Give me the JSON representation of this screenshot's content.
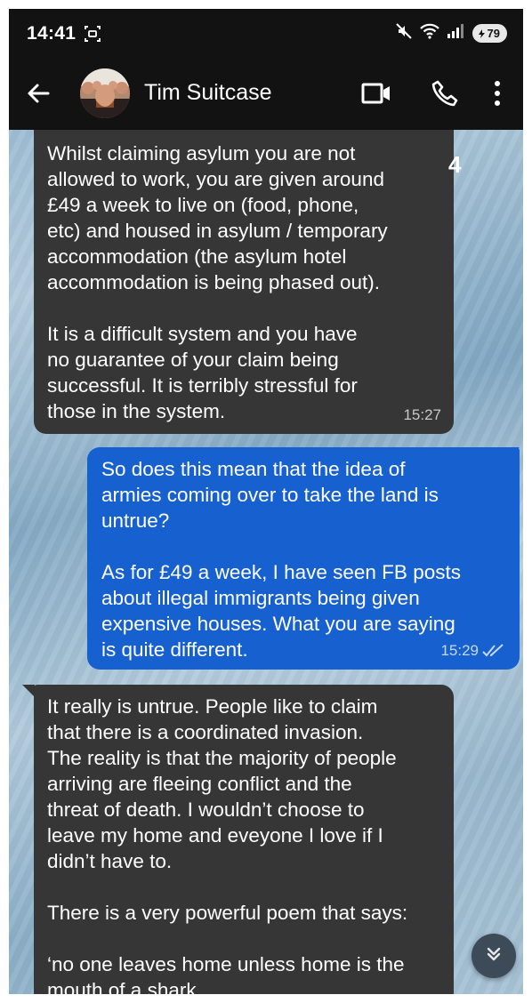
{
  "status_bar": {
    "time": "14:41",
    "battery": "79"
  },
  "header": {
    "contact_name": "Tim Suitcase"
  },
  "overlay": {
    "page_number": "4"
  },
  "messages": [
    {
      "direction": "incoming",
      "paragraphs": [
        [
          "Whilst claiming asylum you are not",
          "allowed to work, you are given around",
          "£49 a week to live on (food, phone,",
          "etc) and housed in asylum / temporary",
          "accommodation (the asylum hotel",
          "accommodation is being phased out)."
        ],
        [
          "It is a difficult system and you have",
          "no guarantee of your claim being",
          "successful. It is terribly stressful for",
          "those in the system."
        ]
      ],
      "time": "15:27"
    },
    {
      "direction": "outgoing",
      "paragraphs": [
        [
          "So does this mean that the idea of",
          "armies coming over to take the land is",
          "untrue?"
        ],
        [
          "As for £49 a week, I have seen FB posts",
          "about illegal immigrants being given",
          "expensive houses. What you are saying",
          "is quite different."
        ]
      ],
      "time": "15:29",
      "status": "read"
    },
    {
      "direction": "incoming",
      "paragraphs": [
        [
          "It really is untrue. People like to claim",
          "that there is a coordinated invasion.",
          "The reality is that the majority of people",
          "arriving are fleeing conflict and the",
          "threat of death. I wouldn’t choose to",
          "leave my home and eveyone I love if I",
          "didn’t have to."
        ],
        [
          "There is a very powerful poem that says:"
        ],
        [
          "‘no one leaves home unless home is the",
          "mouth of a shark,"
        ]
      ]
    }
  ],
  "colors": {
    "app_bar": "#121212",
    "incoming_bubble": "#363636",
    "outgoing_bubble": "#1760d0",
    "wallpaper": "#8ab1cc"
  },
  "icons": [
    "screen-record-icon",
    "mute-icon",
    "wifi-icon",
    "signal-icon",
    "battery-icon",
    "back-arrow-icon",
    "video-call-icon",
    "phone-call-icon",
    "more-vertical-icon",
    "double-check-icon",
    "chevron-double-down-icon"
  ]
}
